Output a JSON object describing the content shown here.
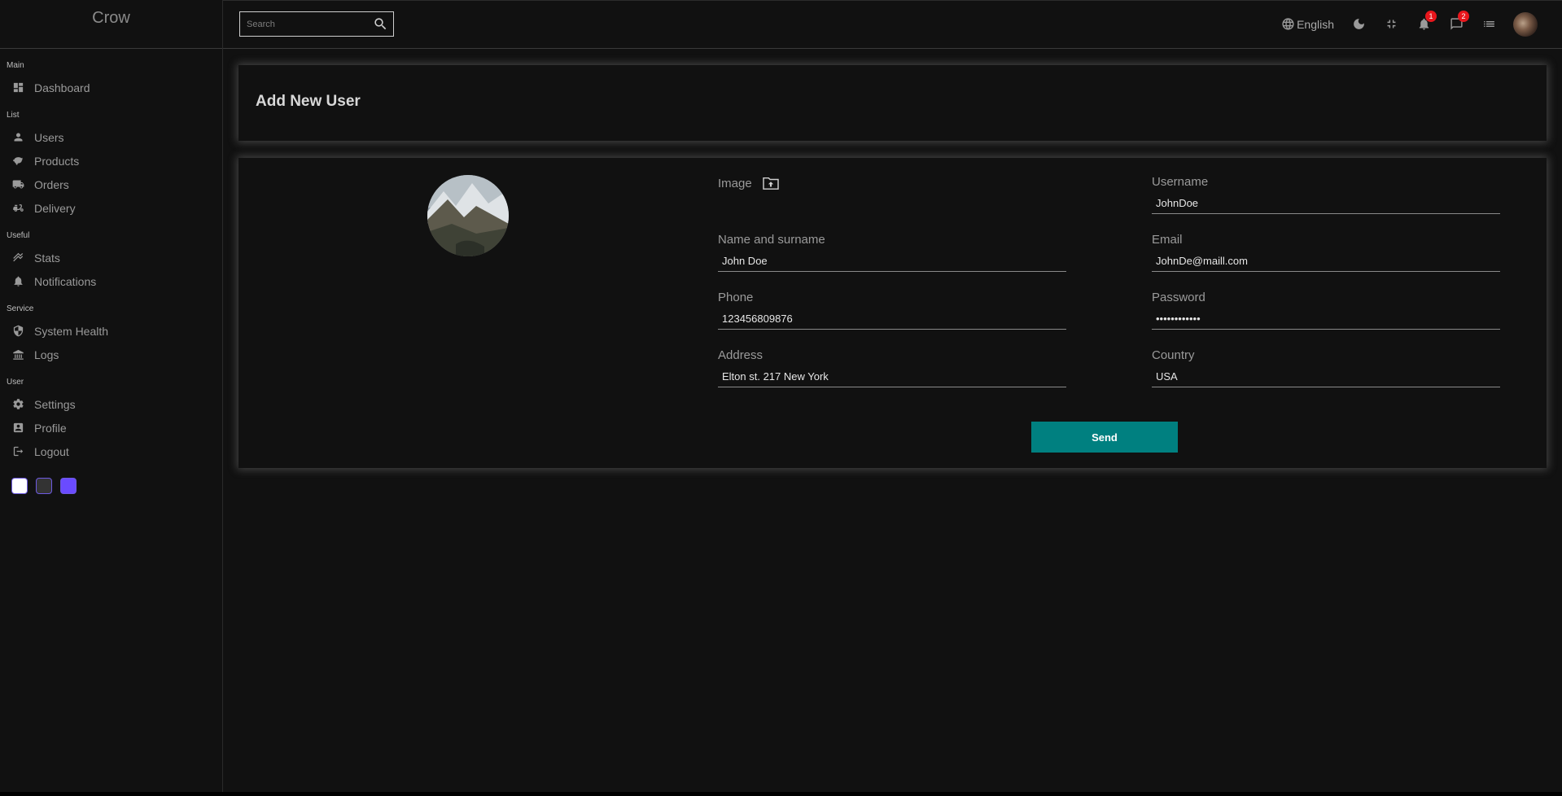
{
  "app": {
    "logo": "Crow"
  },
  "sidebar": {
    "sections": [
      {
        "title": "Main",
        "items": [
          {
            "label": "Dashboard",
            "icon": "dashboard-icon"
          }
        ]
      },
      {
        "title": "List",
        "items": [
          {
            "label": "Users",
            "icon": "person-icon"
          },
          {
            "label": "Products",
            "icon": "products-icon"
          },
          {
            "label": "Orders",
            "icon": "truck-icon"
          },
          {
            "label": "Delivery",
            "icon": "delivery-icon"
          }
        ]
      },
      {
        "title": "Useful",
        "items": [
          {
            "label": "Stats",
            "icon": "stats-icon"
          },
          {
            "label": "Notifications",
            "icon": "bell-icon"
          }
        ]
      },
      {
        "title": "Service",
        "items": [
          {
            "label": "System Health",
            "icon": "shield-icon"
          },
          {
            "label": "Logs",
            "icon": "logs-icon"
          }
        ]
      },
      {
        "title": "User",
        "items": [
          {
            "label": "Settings",
            "icon": "gear-icon"
          },
          {
            "label": "Profile",
            "icon": "profile-icon"
          },
          {
            "label": "Logout",
            "icon": "logout-icon"
          }
        ]
      }
    ],
    "themes": [
      {
        "name": "light",
        "color": "#ffffff"
      },
      {
        "name": "dark",
        "color": "#333333"
      },
      {
        "name": "purple",
        "color": "#6439ff"
      }
    ]
  },
  "topbar": {
    "search_placeholder": "Search",
    "language": "English",
    "notifications_count": "1",
    "messages_count": "2"
  },
  "page": {
    "title": "Add New User"
  },
  "form": {
    "image_label": "Image",
    "fields": {
      "username": {
        "label": "Username",
        "value": "JohnDoe"
      },
      "name": {
        "label": "Name and surname",
        "value": "John Doe"
      },
      "email": {
        "label": "Email",
        "value": "JohnDe@maill.com"
      },
      "phone": {
        "label": "Phone",
        "value": "123456809876"
      },
      "password": {
        "label": "Password",
        "value": "************"
      },
      "address": {
        "label": "Address",
        "value": "Elton st. 217 New York"
      },
      "country": {
        "label": "Country",
        "value": "USA"
      }
    },
    "send_label": "Send"
  },
  "colors": {
    "accent": "#008080",
    "badge": "#e8161c",
    "background": "#111111"
  }
}
